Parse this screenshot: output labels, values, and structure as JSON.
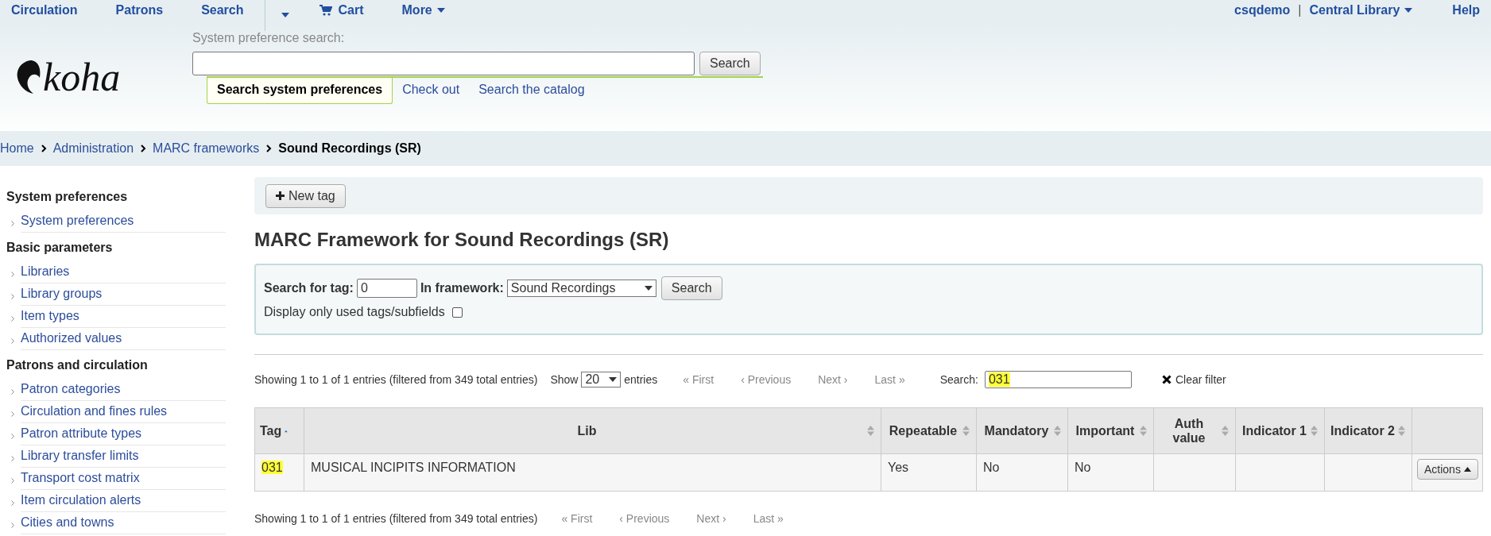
{
  "top_nav": {
    "items": [
      {
        "label": "Circulation",
        "kind": "link"
      },
      {
        "label": "Patrons",
        "kind": "link"
      },
      {
        "label": "Search",
        "kind": "link"
      },
      {
        "kind": "dropdown"
      },
      {
        "label": "Cart",
        "kind": "cart"
      },
      {
        "label": "More",
        "kind": "menu"
      }
    ],
    "user": "csqdemo",
    "separator": "|",
    "library": "Central Library",
    "help": "Help"
  },
  "header": {
    "logo": "koha",
    "search_label": "System preference search:",
    "search_button": "Search",
    "tabs": [
      {
        "label": "Search system preferences",
        "selected": true
      },
      {
        "label": "Check out",
        "selected": false
      },
      {
        "label": "Search the catalog",
        "selected": false
      }
    ]
  },
  "breadcrumb": [
    {
      "label": "Home",
      "current": false
    },
    {
      "label": "Administration",
      "current": false
    },
    {
      "label": "MARC frameworks",
      "current": false
    },
    {
      "label": "Sound Recordings (SR)",
      "current": true
    }
  ],
  "sidebar": {
    "sections": [
      {
        "title": "System preferences",
        "items": [
          "System preferences"
        ]
      },
      {
        "title": "Basic parameters",
        "items": [
          "Libraries",
          "Library groups",
          "Item types",
          "Authorized values"
        ]
      },
      {
        "title": "Patrons and circulation",
        "items": [
          "Patron categories",
          "Circulation and fines rules",
          "Patron attribute types",
          "Library transfer limits",
          "Transport cost matrix",
          "Item circulation alerts",
          "Cities and towns"
        ]
      }
    ]
  },
  "toolbar": {
    "new_button": "New tag"
  },
  "title": "MARC Framework for Sound Recordings (SR)",
  "filter": {
    "tag_label": "Search for tag:",
    "tag_value": "0",
    "framework_label": "In framework:",
    "framework_value": "Sound Recordings",
    "search_button": "Search",
    "used_label": "Display only used tags/subfields",
    "used_checked": false
  },
  "table_top": {
    "info": "Showing 1 to 1 of 1 entries (filtered from 349 total entries)",
    "show_label": "Show",
    "page_size": "20",
    "entries_label": "entries",
    "pager": [
      {
        "label": "« First",
        "disabled": true
      },
      {
        "label": "‹ Previous",
        "disabled": true
      },
      {
        "label": "Next ›",
        "disabled": true
      },
      {
        "label": "Last »",
        "disabled": true
      }
    ],
    "search_label": "Search:",
    "search_value": "031",
    "search_highlighted": true,
    "clear_filter": "Clear filter"
  },
  "table": {
    "columns": [
      {
        "label": "Tag",
        "sortable": true,
        "sorted": true
      },
      {
        "label": "Lib",
        "sortable": true,
        "sorted": false
      },
      {
        "label": "Repeatable",
        "sortable": true,
        "sorted": false
      },
      {
        "label": "Mandatory",
        "sortable": true,
        "sorted": false
      },
      {
        "label": "Important",
        "sortable": true,
        "sorted": false
      },
      {
        "label": "Auth value",
        "sortable": true,
        "sorted": false
      },
      {
        "label": "Indicator 1",
        "sortable": true,
        "sorted": false
      },
      {
        "label": "Indicator 2",
        "sortable": true,
        "sorted": false
      },
      {
        "sortable": false
      }
    ],
    "rows": [
      {
        "tag": "031",
        "tag_highlighted": true,
        "lib": "MUSICAL INCIPITS INFORMATION",
        "repeatable": "Yes",
        "mandatory": "No",
        "important": "No",
        "auth_value": "",
        "indicator_1": "",
        "indicator_2": "",
        "action": "Actions"
      }
    ]
  },
  "table_bottom": {
    "info": "Showing 1 to 1 of 1 entries (filtered from 349 total entries)",
    "pager": [
      {
        "label": "« First",
        "disabled": true
      },
      {
        "label": "‹ Previous",
        "disabled": true
      },
      {
        "label": "Next ›",
        "disabled": true
      },
      {
        "label": "Last »",
        "disabled": true
      }
    ]
  }
}
